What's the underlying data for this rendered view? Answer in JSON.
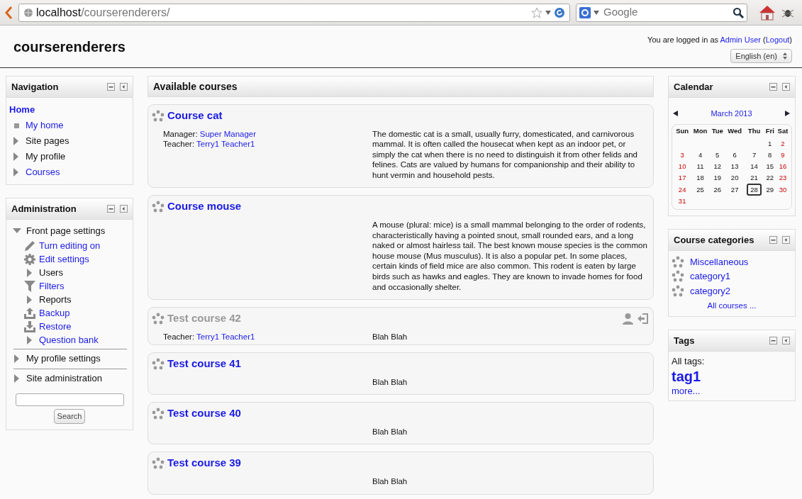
{
  "browser": {
    "url_host": "localhost",
    "url_path": "/courserenderers/",
    "search_placeholder": "Google"
  },
  "header": {
    "site_title": "courserenderers",
    "login_prefix": "You are logged in as",
    "user": "Admin User",
    "logout_open": "(",
    "logout": "Logout",
    "logout_close": ")",
    "language": "English (en)"
  },
  "navigation": {
    "title": "Navigation",
    "items": [
      {
        "label": "Home",
        "kind": "home",
        "link": true
      },
      {
        "label": "My home",
        "kind": "leaf",
        "link": true
      },
      {
        "label": "Site pages",
        "kind": "branch",
        "link": false,
        "expanded": false
      },
      {
        "label": "My profile",
        "kind": "branch",
        "link": false,
        "expanded": false
      },
      {
        "label": "Courses",
        "kind": "branch",
        "link": true,
        "expanded": false
      }
    ]
  },
  "administration": {
    "title": "Administration",
    "items": [
      {
        "label": "Front page settings",
        "kind": "branch",
        "link": false,
        "expanded": true,
        "children": [
          {
            "label": "Turn editing on",
            "kind": "pencil",
            "link": true
          },
          {
            "label": "Edit settings",
            "kind": "gear",
            "link": true
          },
          {
            "label": "Users",
            "kind": "branch",
            "link": false,
            "expanded": false
          },
          {
            "label": "Filters",
            "kind": "filter",
            "link": true
          },
          {
            "label": "Reports",
            "kind": "branch",
            "link": false,
            "expanded": false
          },
          {
            "label": "Backup",
            "kind": "upload",
            "link": true
          },
          {
            "label": "Restore",
            "kind": "download",
            "link": true
          },
          {
            "label": "Question bank",
            "kind": "branch",
            "link": true,
            "expanded": false
          }
        ]
      },
      {
        "label": "My profile settings",
        "kind": "branch",
        "link": false,
        "expanded": false
      },
      {
        "label": "Site administration",
        "kind": "branch",
        "link": false,
        "expanded": false
      }
    ],
    "search_button": "Search"
  },
  "available_courses": {
    "title": "Available courses",
    "courses": [
      {
        "name": "Course cat",
        "dimmed": false,
        "enrol_icons": false,
        "contacts": [
          {
            "role": "Manager:",
            "name": "Super Manager"
          },
          {
            "role": "Teacher:",
            "name": "Terry1 Teacher1"
          }
        ],
        "summary": "The domestic cat is a small, usually furry, domesticated, and carnivorous mammal. It is often called the housecat when kept as an indoor pet, or simply the cat when there is no need to distinguish it from other felids and felines. Cats are valued by humans for companionship and their ability to hunt vermin and household pests."
      },
      {
        "name": "Course mouse",
        "dimmed": false,
        "enrol_icons": false,
        "summary": "A mouse (plural: mice) is a small mammal belonging to the order of rodents, characteristically having a pointed snout, small rounded ears, and a long naked or almost hairless tail. The best known mouse species is the common house mouse (Mus musculus). It is also a popular pet. In some places, certain kinds of field mice are also common. This rodent is eaten by large birds such as hawks and eagles. They are known to invade homes for food and occasionally shelter."
      },
      {
        "name": "Test course 42",
        "dimmed": true,
        "enrol_icons": true,
        "contacts": [
          {
            "role": "Teacher:",
            "name": "Terry1 Teacher1"
          }
        ],
        "summary": "Blah Blah"
      },
      {
        "name": "Test course 41",
        "dimmed": false,
        "enrol_icons": false,
        "summary": "Blah Blah"
      },
      {
        "name": "Test course 40",
        "dimmed": false,
        "enrol_icons": false,
        "summary": "Blah Blah"
      },
      {
        "name": "Test course 39",
        "dimmed": false,
        "enrol_icons": false,
        "summary": "Blah Blah"
      }
    ]
  },
  "calendar": {
    "title": "Calendar",
    "month": "March 2013",
    "weekdays": [
      "Sun",
      "Mon",
      "Tue",
      "Wed",
      "Thu",
      "Fri",
      "Sat"
    ],
    "weeks": [
      [
        {
          "day": "1",
          "today": false
        },
        {
          "day": "2",
          "today": false
        }
      ],
      [
        {
          "day": "3",
          "today": false
        },
        {
          "day": "4",
          "today": false
        },
        {
          "day": "5",
          "today": false
        },
        {
          "day": "6",
          "today": false
        },
        {
          "day": "7",
          "today": false
        },
        {
          "day": "8",
          "today": false
        },
        {
          "day": "9",
          "today": false
        }
      ],
      [
        {
          "day": "10",
          "today": false
        },
        {
          "day": "11",
          "today": false
        },
        {
          "day": "12",
          "today": false
        },
        {
          "day": "13",
          "today": false
        },
        {
          "day": "14",
          "today": false
        },
        {
          "day": "15",
          "today": false
        },
        {
          "day": "16",
          "today": false
        }
      ],
      [
        {
          "day": "17",
          "today": false
        },
        {
          "day": "18",
          "today": false
        },
        {
          "day": "19",
          "today": false
        },
        {
          "day": "20",
          "today": false
        },
        {
          "day": "21",
          "today": false
        },
        {
          "day": "22",
          "today": false
        },
        {
          "day": "23",
          "today": false
        }
      ],
      [
        {
          "day": "24",
          "today": false
        },
        {
          "day": "25",
          "today": false
        },
        {
          "day": "26",
          "today": false
        },
        {
          "day": "27",
          "today": false
        },
        {
          "day": "28",
          "today": true
        },
        {
          "day": "29",
          "today": false
        },
        {
          "day": "30",
          "today": false
        }
      ],
      [
        {
          "day": "31",
          "today": false
        }
      ]
    ]
  },
  "course_categories": {
    "title": "Course categories",
    "items": [
      "Miscellaneous",
      "category1",
      "category2"
    ],
    "all_link": "All courses ..."
  },
  "tags": {
    "title": "Tags",
    "label": "All tags:",
    "tags": [
      "tag1"
    ],
    "more": "more..."
  }
}
